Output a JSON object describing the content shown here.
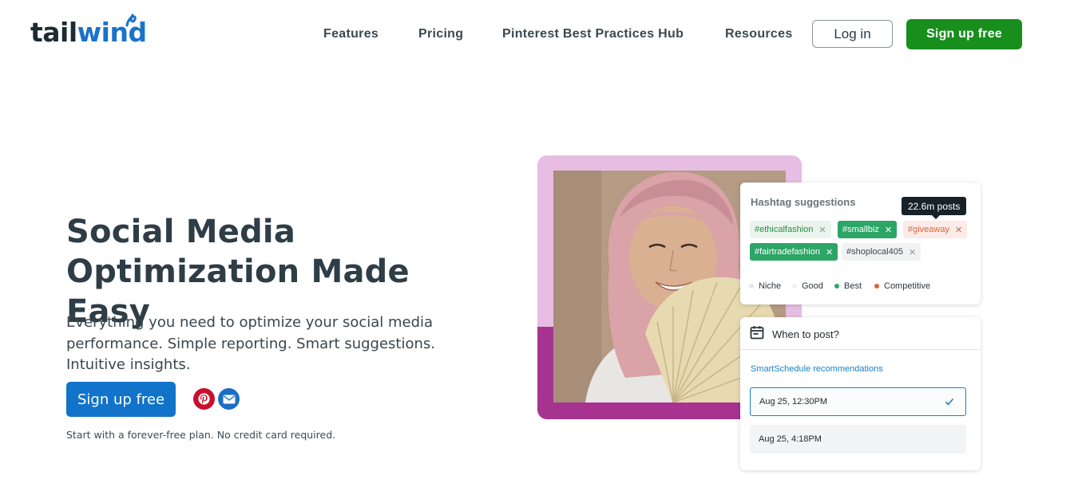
{
  "header": {
    "logo": {
      "text_prefix": "tail",
      "text_accent": "wind",
      "brand_color": "#1a73c9"
    },
    "nav": [
      {
        "label": "Features"
      },
      {
        "label": "Pricing"
      },
      {
        "label": "Pinterest Best Practices Hub"
      },
      {
        "label": "Resources"
      }
    ],
    "login_label": "Log in",
    "signup_label": "Sign up free"
  },
  "hero": {
    "title_line1": "Social Media",
    "title_line2": "Optimization Made Easy",
    "subtitle": "Everything you need to optimize your social media performance. Simple reporting. Smart suggestions. Intuitive insights.",
    "cta_label": "Sign up free",
    "share_icons": [
      "pinterest-icon",
      "email-icon"
    ],
    "fine_print": "Start with a forever-free plan. No credit card required."
  },
  "hashtag_card": {
    "title": "Hashtag suggestions",
    "tooltip": "22.6m posts",
    "tags": [
      {
        "label": "#ethicalfashion",
        "kind": "Good"
      },
      {
        "label": "#smallbiz",
        "kind": "Best"
      },
      {
        "label": "#giveaway",
        "kind": "Competitive"
      },
      {
        "label": "#fairtradefashion",
        "kind": "Best"
      },
      {
        "label": "#shoplocal405",
        "kind": "Niche"
      }
    ],
    "legend": [
      {
        "label": "Niche",
        "color": "#e4e6e8"
      },
      {
        "label": "Good",
        "color": "#e9f4ec"
      },
      {
        "label": "Best",
        "color": "#2ca567"
      },
      {
        "label": "Competitive",
        "color": "#e0623c"
      }
    ]
  },
  "when_card": {
    "title": "When to post?",
    "smart_label": "SmartSchedule recommendations",
    "slots": [
      {
        "label": "Aug 25, 12:30PM",
        "selected": true
      },
      {
        "label": "Aug 25, 4:18PM",
        "selected": false
      }
    ]
  },
  "colors": {
    "green_cta": "#188e1d",
    "blue_cta": "#1173c9",
    "frame_pink": "#e7bde3",
    "frame_magenta": "#a73391"
  }
}
